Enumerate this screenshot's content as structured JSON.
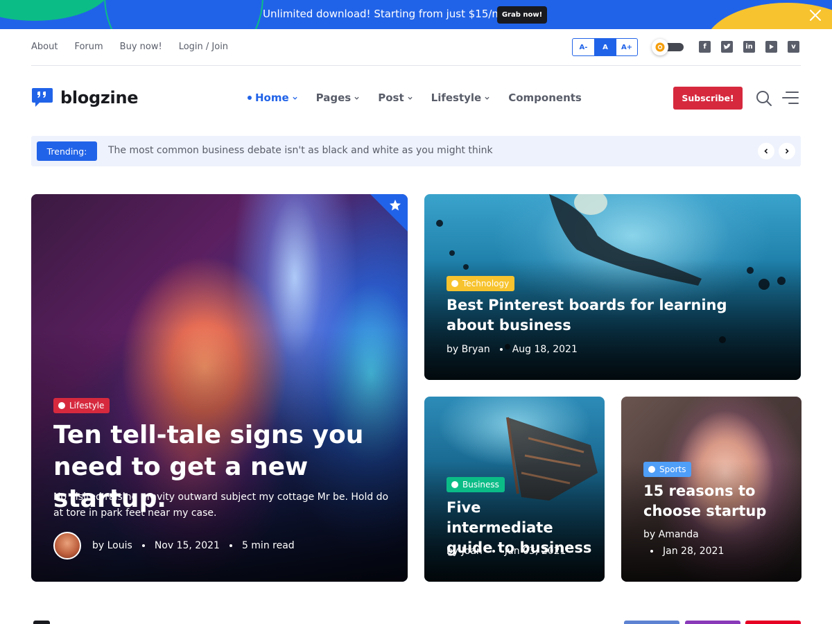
{
  "promo": {
    "text": "Unlimited download! Starting from just $15/m",
    "button": "Grab now!"
  },
  "topnav": {
    "links": [
      "About",
      "Forum",
      "Buy now!",
      "Login / Join"
    ]
  },
  "font_size": {
    "small": "A-",
    "normal": "A",
    "large": "A+",
    "selected": "A"
  },
  "social_icons": [
    "facebook-icon",
    "twitter-icon",
    "linkedin-icon",
    "youtube-icon",
    "vimeo-icon"
  ],
  "brand": {
    "name": "blogzine"
  },
  "mainnav": {
    "items": [
      "Home",
      "Pages",
      "Post",
      "Lifestyle",
      "Components"
    ],
    "active": "Home"
  },
  "subscribe": "Subscribe!",
  "trending": {
    "label": "Trending:",
    "text": "The most common business debate isn't as black and white as you might think"
  },
  "featured": {
    "category": "Lifestyle",
    "title": "Ten tell-tale signs you need to get a new startup.",
    "excerpt": "No visited raising gravity outward subject my cottage Mr be. Hold do at tore in park feet near my case.",
    "author": "by Louis",
    "date": "Nov 15, 2021",
    "read_time": "5 min read"
  },
  "posts": [
    {
      "category": "Technology",
      "title": "Best Pinterest boards for learning about business",
      "author": "by Bryan",
      "date": "Aug 18, 2021"
    },
    {
      "category": "Business",
      "title": "Five intermediate guide to business",
      "author": "by Joan",
      "date": "Jun 03, 2021"
    },
    {
      "category": "Sports",
      "title": "15 reasons to choose startup",
      "author": "by Amanda",
      "date": "Jan 28, 2021"
    }
  ],
  "colors": {
    "primary": "#2163e8",
    "danger": "#d6293e",
    "warning": "#f7c32e",
    "success": "#0cbc87",
    "info": "#4f9ef8"
  }
}
